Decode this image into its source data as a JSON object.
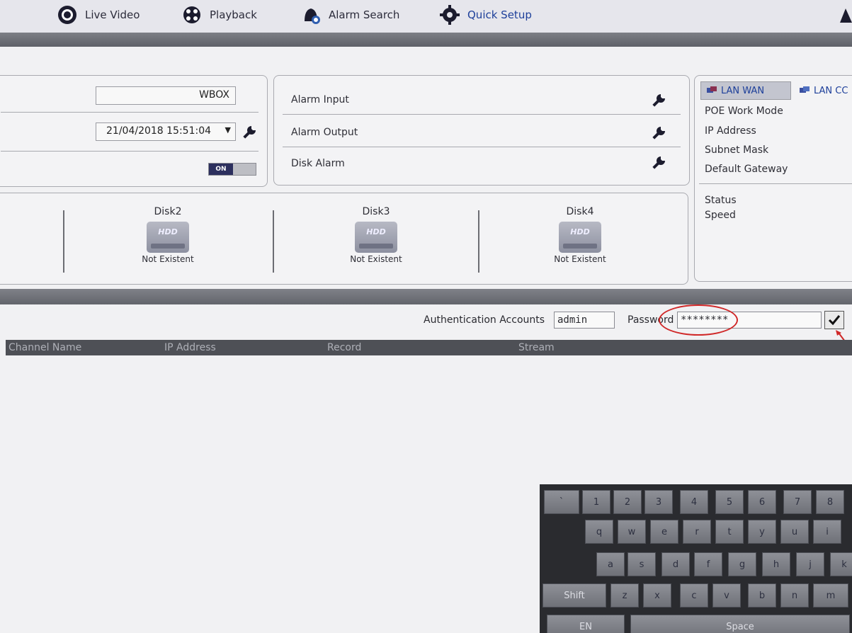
{
  "nav": {
    "items": [
      {
        "label": "Live Video",
        "icon": "live-video-icon"
      },
      {
        "label": "Playback",
        "icon": "playback-icon"
      },
      {
        "label": "Alarm Search",
        "icon": "alarm-search-icon"
      },
      {
        "label": "Quick Setup",
        "icon": "quick-setup-icon",
        "active": true
      }
    ]
  },
  "general": {
    "device_name": "WBOX",
    "datetime": "21/04/2018 15:51:04",
    "toggle_label": "ON"
  },
  "alarm": {
    "items": [
      "Alarm Input",
      "Alarm Output",
      "Disk Alarm"
    ]
  },
  "disks": [
    {
      "name": "Disk2",
      "badge": "HDD",
      "status": "Not Existent"
    },
    {
      "name": "Disk3",
      "badge": "HDD",
      "status": "Not Existent"
    },
    {
      "name": "Disk4",
      "badge": "HDD",
      "status": "Not Existent"
    }
  ],
  "network": {
    "tabs": [
      "LAN WAN",
      "LAN CC"
    ],
    "fields": [
      "POE Work Mode",
      "IP Address",
      "Subnet Mask",
      "Default Gateway"
    ],
    "status_fields": [
      "Status",
      "Speed"
    ]
  },
  "auth": {
    "accounts_label": "Authentication Accounts",
    "accounts_value": "admin",
    "password_label": "Password",
    "password_value": "********"
  },
  "table": {
    "columns": [
      "Channel Name",
      "IP Address",
      "Record",
      "Stream"
    ]
  },
  "keyboard": {
    "row1": [
      "`",
      "1",
      "2",
      "3",
      "4",
      "5",
      "6",
      "7",
      "8"
    ],
    "row2": [
      "q",
      "w",
      "e",
      "r",
      "t",
      "y",
      "u",
      "i"
    ],
    "row3": [
      "a",
      "s",
      "d",
      "f",
      "g",
      "h",
      "j",
      "k"
    ],
    "row4": [
      "Shift",
      "z",
      "x",
      "c",
      "v",
      "b",
      "n",
      "m"
    ],
    "row5": [
      "EN",
      "Space"
    ]
  },
  "colors": {
    "accent": "#1d3f9a",
    "annotation": "#d02828"
  }
}
